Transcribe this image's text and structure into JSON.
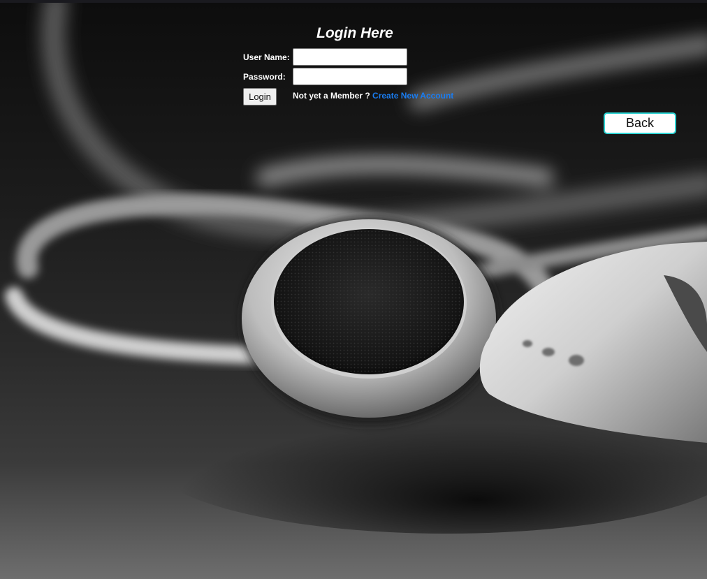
{
  "login": {
    "title": "Login Here",
    "username_label": "User Name:",
    "password_label": "Password:",
    "username_value": "",
    "password_value": "",
    "login_button": "Login",
    "member_prompt": "Not yet a Member ?",
    "create_account_link": "Create New Account"
  },
  "nav": {
    "back_button": "Back"
  },
  "colors": {
    "link": "#1a7cf0",
    "back_border": "#2fd4d4",
    "background": "#000000"
  }
}
